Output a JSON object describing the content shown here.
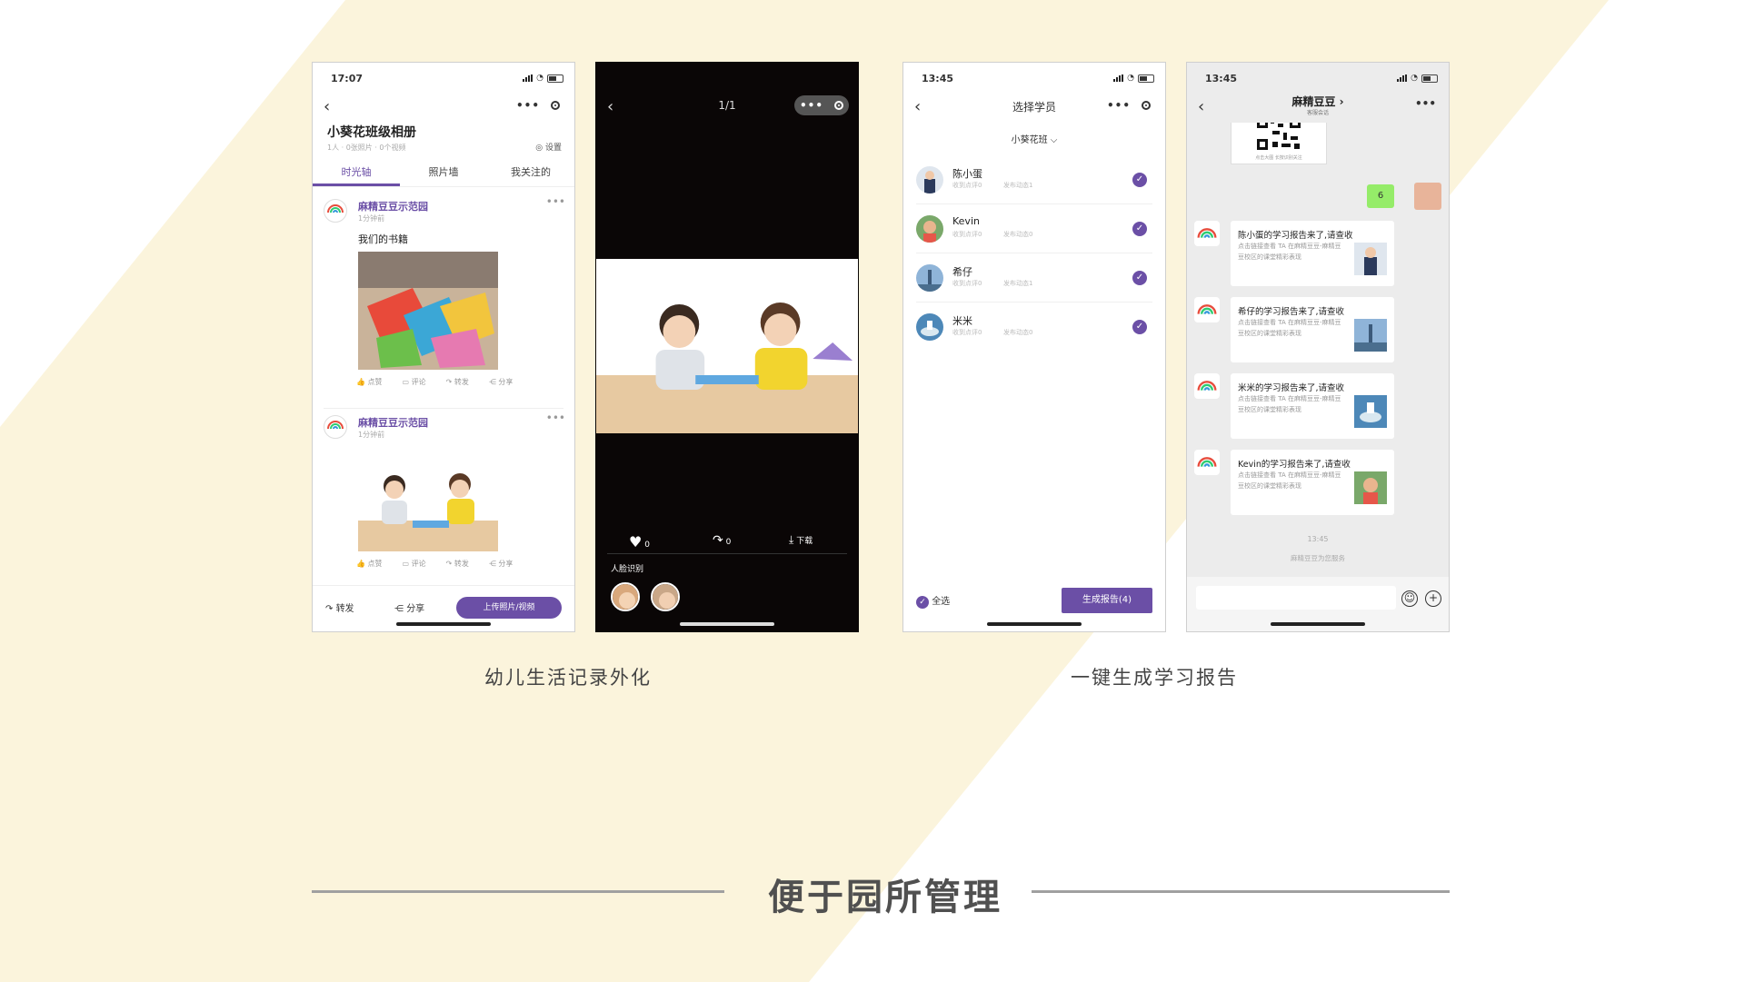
{
  "colors": {
    "background": "#fbf4dc",
    "accent_purple": "#6b4fa6",
    "chat_green": "#95ec69"
  },
  "captions": {
    "left": "幼儿生活记录外化",
    "right": "一键生成学习报告"
  },
  "footer_title": "便于园所管理",
  "phone1": {
    "time": "17:07",
    "album_title": "小葵花班级相册",
    "album_sub": "1人 · 0张照片 · 0个视频",
    "settings": "设置",
    "tabs": [
      "时光轴",
      "照片墙",
      "我关注的"
    ],
    "posts": [
      {
        "author": "麻精豆豆示范园",
        "time": "1分钟前",
        "text": "我们的书籍"
      },
      {
        "author": "麻精豆豆示范园",
        "time": "1分钟前",
        "text": ""
      }
    ],
    "actions": [
      "点赞",
      "评论",
      "转发",
      "分享"
    ],
    "bottom": {
      "forward": "转发",
      "share": "分享",
      "upload": "上传照片/视频"
    }
  },
  "phone2": {
    "counter": "1/1",
    "likes": "0",
    "shares": "0",
    "download": "下载",
    "face_label": "人脸识别"
  },
  "phone3": {
    "time": "13:45",
    "title": "选择学员",
    "class_name": "小葵花班",
    "students": [
      {
        "name": "陈小蛋",
        "reviews": "收到点评0",
        "posts": "发布动态1"
      },
      {
        "name": "Kevin",
        "reviews": "收到点评0",
        "posts": "发布动态0"
      },
      {
        "name": "希仔",
        "reviews": "收到点评0",
        "posts": "发布动态1"
      },
      {
        "name": "米米",
        "reviews": "收到点评0",
        "posts": "发布动态0"
      }
    ],
    "select_all": "全选",
    "generate": "生成报告(4)"
  },
  "phone4": {
    "time": "13:45",
    "chat_title": "麻精豆豆 ›",
    "chat_sub": "客服会话",
    "qr_caption": "点击大图 长按识别关注",
    "my_message": "6",
    "messages": [
      {
        "title": "陈小蛋的学习报告来了,请查收",
        "desc": "点击链接查看 TA 在麻精豆豆-麻精豆豆校区的课堂精彩表现"
      },
      {
        "title": "希仔的学习报告来了,请查收",
        "desc": "点击链接查看 TA 在麻精豆豆-麻精豆豆校区的课堂精彩表现"
      },
      {
        "title": "米米的学习报告来了,请查收",
        "desc": "点击链接查看 TA 在麻精豆豆-麻精豆豆校区的课堂精彩表现"
      },
      {
        "title": "Kevin的学习报告来了,请查收",
        "desc": "点击链接查看 TA 在麻精豆豆-麻精豆豆校区的课堂精彩表现"
      }
    ],
    "chat_time": "13:45",
    "service_note": "麻精豆豆为您服务"
  }
}
